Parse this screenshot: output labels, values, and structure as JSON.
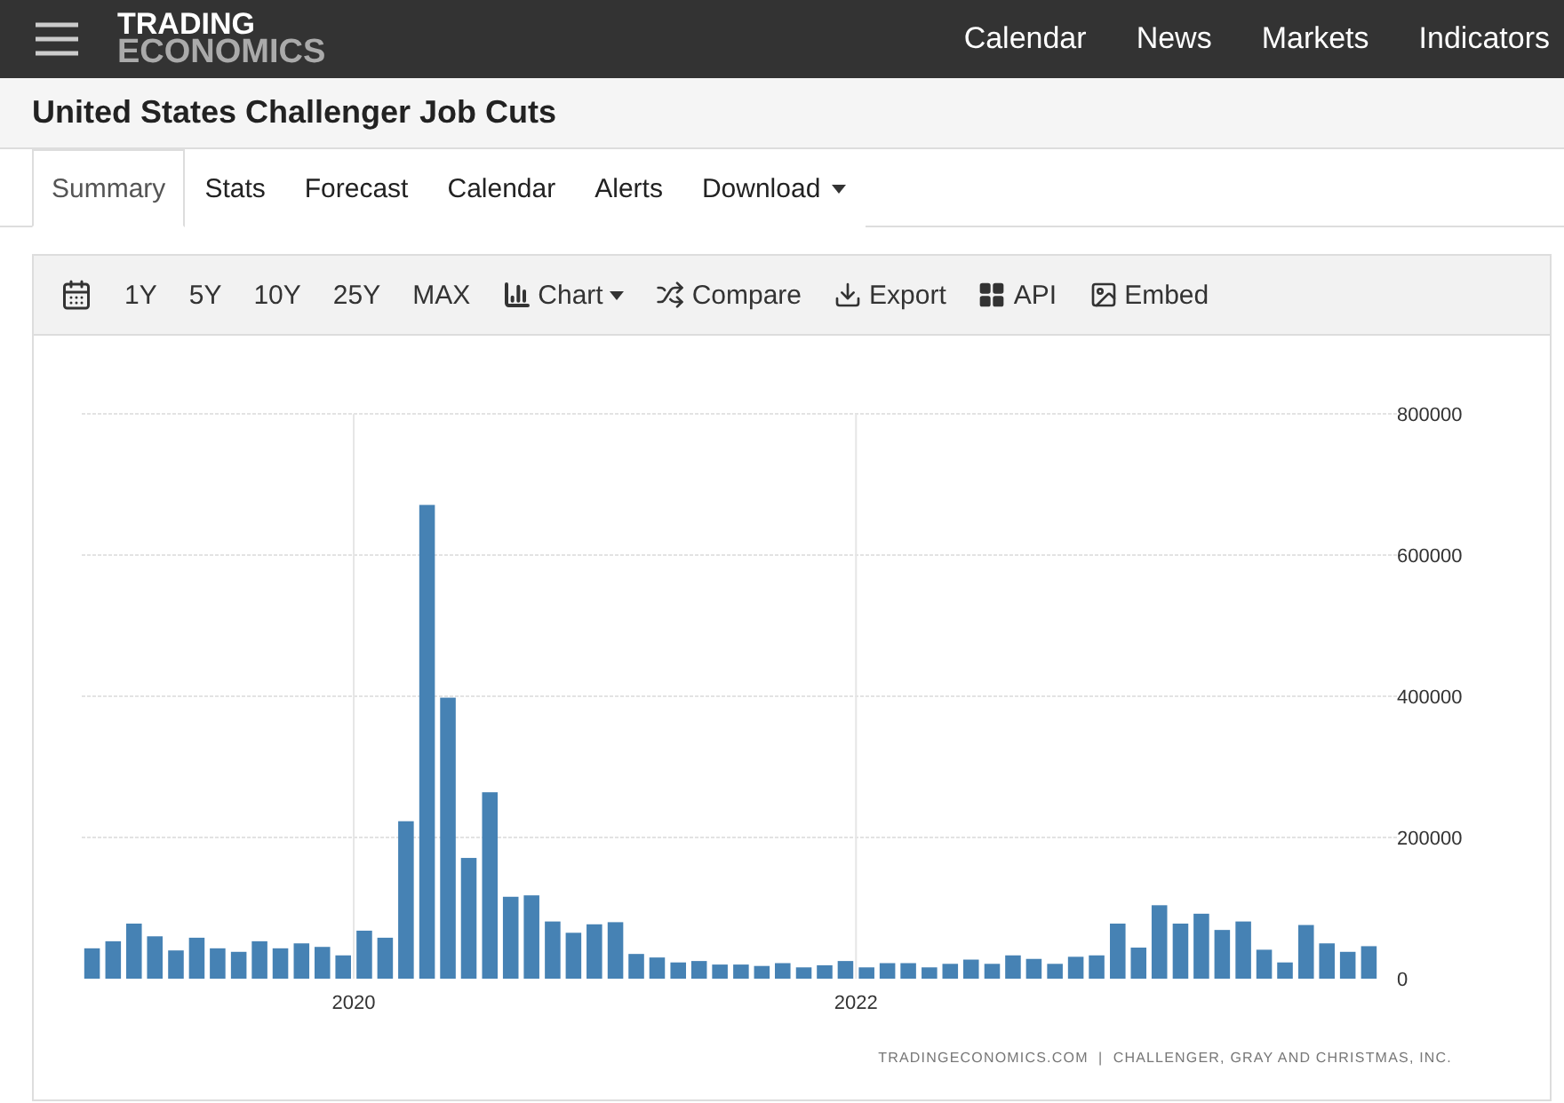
{
  "header": {
    "logo": [
      "TRADING",
      "ECONOMICS"
    ],
    "nav": [
      "Calendar",
      "News",
      "Markets",
      "Indicators"
    ]
  },
  "title": "United States Challenger Job Cuts",
  "tabs": [
    {
      "label": "Summary",
      "selected": true,
      "kind": "link"
    },
    {
      "label": "Stats",
      "selected": false,
      "kind": "link"
    },
    {
      "label": "Forecast",
      "selected": false,
      "kind": "link"
    },
    {
      "label": "Calendar",
      "selected": false,
      "kind": "link"
    },
    {
      "label": "Alerts",
      "selected": false,
      "kind": "link"
    },
    {
      "label": "Download",
      "selected": false,
      "kind": "dropdown"
    }
  ],
  "toolbar": [
    {
      "kind": "calendar"
    },
    {
      "kind": "range",
      "label": "1Y"
    },
    {
      "kind": "range",
      "label": "5Y"
    },
    {
      "kind": "range",
      "label": "10Y"
    },
    {
      "kind": "range",
      "label": "25Y"
    },
    {
      "kind": "range",
      "label": "MAX"
    },
    {
      "kind": "chart",
      "label": "Chart"
    },
    {
      "kind": "compare",
      "label": "Compare"
    },
    {
      "kind": "export",
      "label": "Export"
    },
    {
      "kind": "api",
      "label": "API"
    },
    {
      "kind": "embed",
      "label": "Embed"
    }
  ],
  "chart_data": {
    "type": "bar",
    "grid": true,
    "x": [
      2018.958,
      2019.042,
      2019.125,
      2019.208,
      2019.292,
      2019.375,
      2019.458,
      2019.542,
      2019.625,
      2019.708,
      2019.792,
      2019.875,
      2019.958,
      2020.042,
      2020.125,
      2020.208,
      2020.292,
      2020.375,
      2020.458,
      2020.542,
      2020.625,
      2020.708,
      2020.792,
      2020.875,
      2020.958,
      2021.042,
      2021.125,
      2021.208,
      2021.292,
      2021.375,
      2021.458,
      2021.542,
      2021.625,
      2021.708,
      2021.792,
      2021.875,
      2021.958,
      2022.042,
      2022.125,
      2022.208,
      2022.292,
      2022.375,
      2022.458,
      2022.542,
      2022.625,
      2022.708,
      2022.792,
      2022.875,
      2022.958,
      2023.042,
      2023.125,
      2023.208,
      2023.292,
      2023.375,
      2023.458,
      2023.542,
      2023.625,
      2023.708,
      2023.792,
      2023.875,
      2023.958,
      2024.042
    ],
    "series": [
      {
        "color": "#4682b4",
        "values": [
          43000,
          53000,
          78000,
          60000,
          40000,
          58000,
          43000,
          38000,
          53000,
          43000,
          50000,
          45000,
          33000,
          68000,
          58000,
          223000,
          671000,
          398000,
          171000,
          264000,
          116000,
          118000,
          81000,
          65000,
          77000,
          80000,
          35000,
          30000,
          23000,
          25000,
          20000,
          20000,
          18000,
          22000,
          16000,
          19000,
          25000,
          16000,
          22000,
          22000,
          16000,
          21000,
          27000,
          21000,
          33000,
          28000,
          21000,
          31000,
          33000,
          78000,
          44000,
          104000,
          78000,
          92000,
          69000,
          81000,
          41000,
          23000,
          76000,
          50000,
          38000,
          46000
        ]
      }
    ],
    "ylim": [
      0,
      800000
    ],
    "yticks": [
      {
        "value": 0,
        "label": "0"
      },
      {
        "value": 200000,
        "label": "200000"
      },
      {
        "value": 400000,
        "label": "400000"
      },
      {
        "value": 600000,
        "label": "600000"
      },
      {
        "value": 800000,
        "label": "800000"
      }
    ],
    "xlim": [
      2018.917,
      2024.083
    ],
    "xticks": [
      {
        "value": 2020,
        "label": "2020"
      },
      {
        "value": 2022,
        "label": "2022"
      }
    ]
  },
  "source": "TRADINGECONOMICS.COM  |  CHALLENGER, GRAY AND CHRISTMAS, INC."
}
